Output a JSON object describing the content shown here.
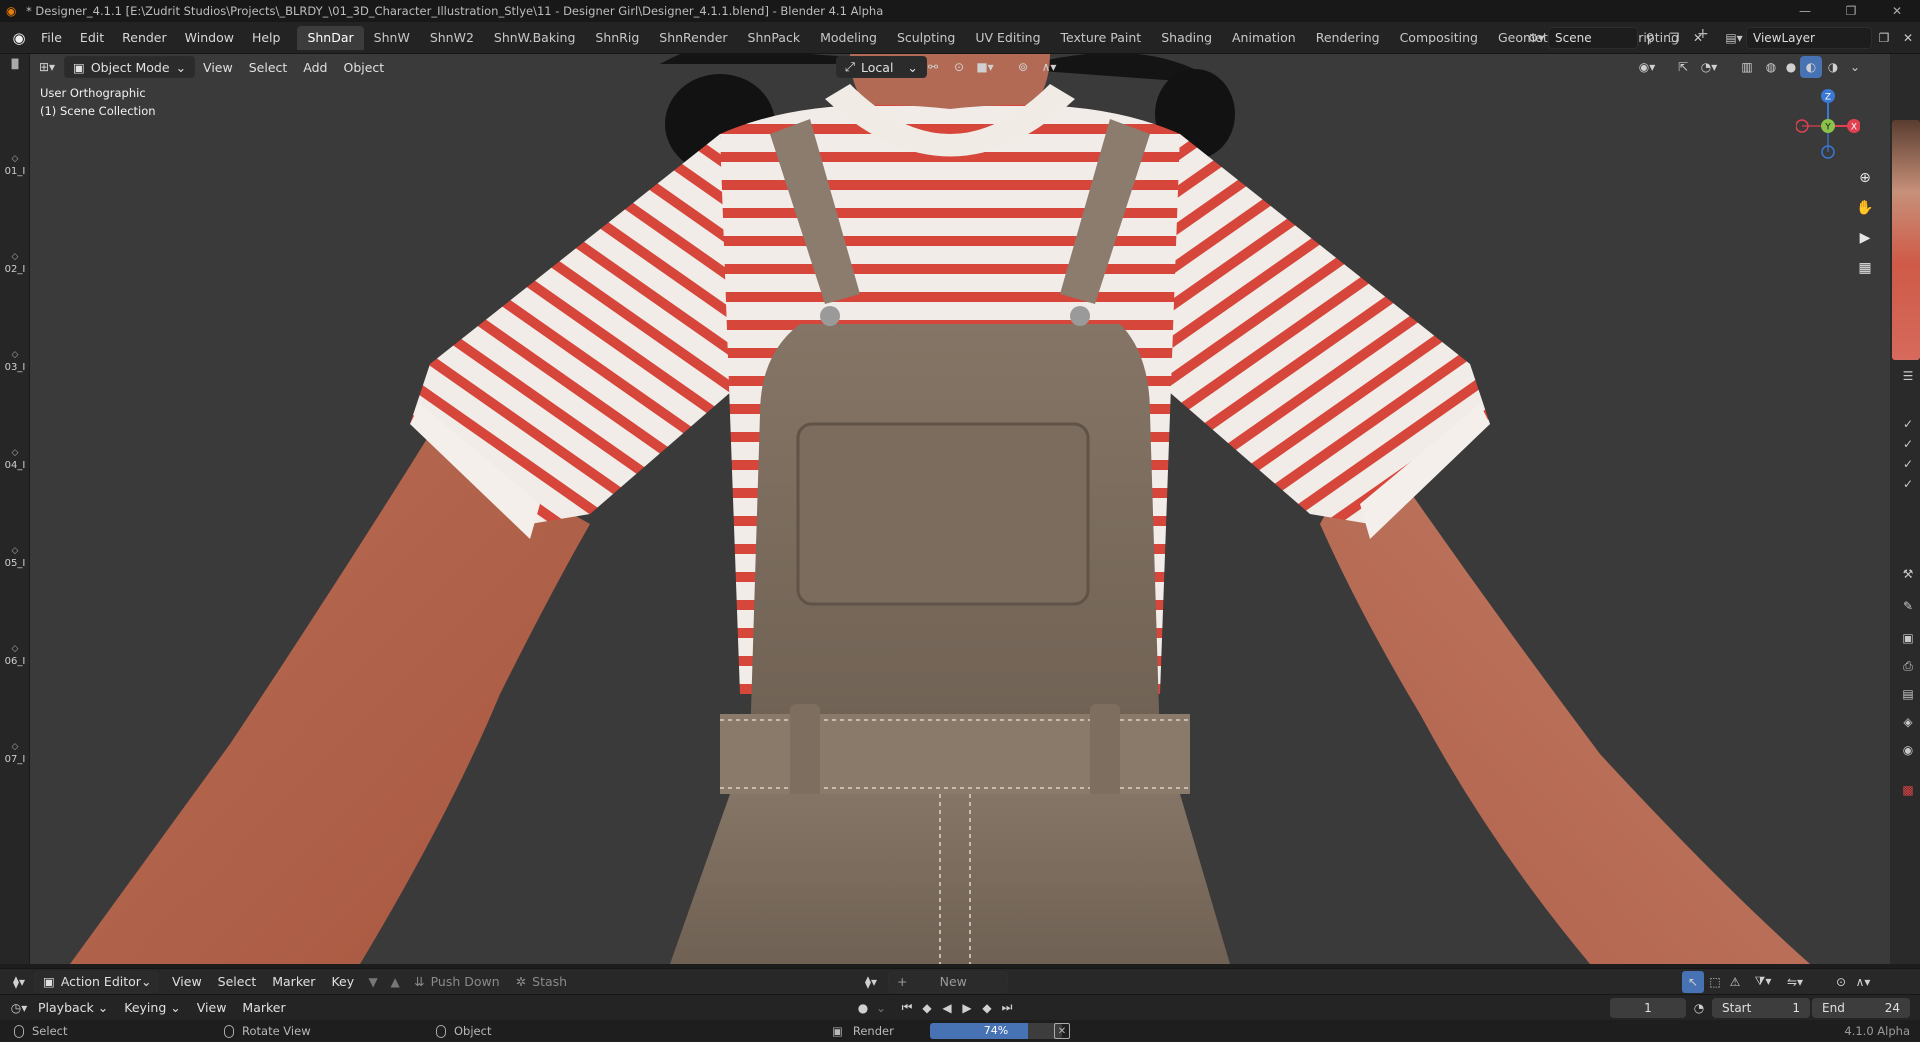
{
  "window": {
    "title": "* Designer_4.1.1 [E:\\Zudrit Studios\\Projects\\_BLRDY_\\01_3D_Character_Illustration_Stlye\\11 - Designer Girl\\Designer_4.1.1.blend] - Blender 4.1 Alpha"
  },
  "topbar": {
    "menus": [
      "File",
      "Edit",
      "Render",
      "Window",
      "Help"
    ],
    "workspaces": [
      "ShnDar",
      "ShnW",
      "ShnW2",
      "ShnW.Baking",
      "ShnRig",
      "ShnRender",
      "ShnPack",
      "Modeling",
      "Sculpting",
      "UV Editing",
      "Texture Paint",
      "Shading",
      "Animation",
      "Rendering",
      "Compositing",
      "Geometry Nodes",
      "Scripting"
    ],
    "active_workspace": "ShnDar",
    "scene": "Scene",
    "view_layer": "ViewLayer"
  },
  "viewport": {
    "mode": "Object Mode",
    "menus": [
      "View",
      "Select",
      "Add",
      "Object"
    ],
    "transform_orientation": "Local",
    "view_name": "User Orthographic",
    "collection": "(1) Scene Collection",
    "gizmo_axes": {
      "z": "Z",
      "y": "Y",
      "x": "X"
    },
    "colors": {
      "background": "#3a3a3a",
      "x_axis": "#e04050",
      "y_axis": "#8bc34a",
      "z_axis": "#3a78d6"
    }
  },
  "left_collections": [
    "01_I",
    "02_I",
    "03_I",
    "04_I",
    "05_I",
    "06_I",
    "07_I"
  ],
  "action_editor": {
    "editor": "Action Editor",
    "menus": [
      "View",
      "Select",
      "Marker",
      "Key"
    ],
    "push_down": "Push Down",
    "stash": "Stash",
    "new_label": "New"
  },
  "timeline": {
    "menus": [
      "Playback",
      "Keying",
      "View",
      "Marker"
    ],
    "current_frame": "1",
    "start_label": "Start",
    "start_value": "1",
    "end_label": "End",
    "end_value": "24"
  },
  "status_bar": {
    "select": "Select",
    "rotate_view": "Rotate View",
    "object": "Object",
    "render_label": "Render",
    "render_progress": "74%",
    "render_fraction": 0.74,
    "version": "4.1.0 Alpha"
  }
}
